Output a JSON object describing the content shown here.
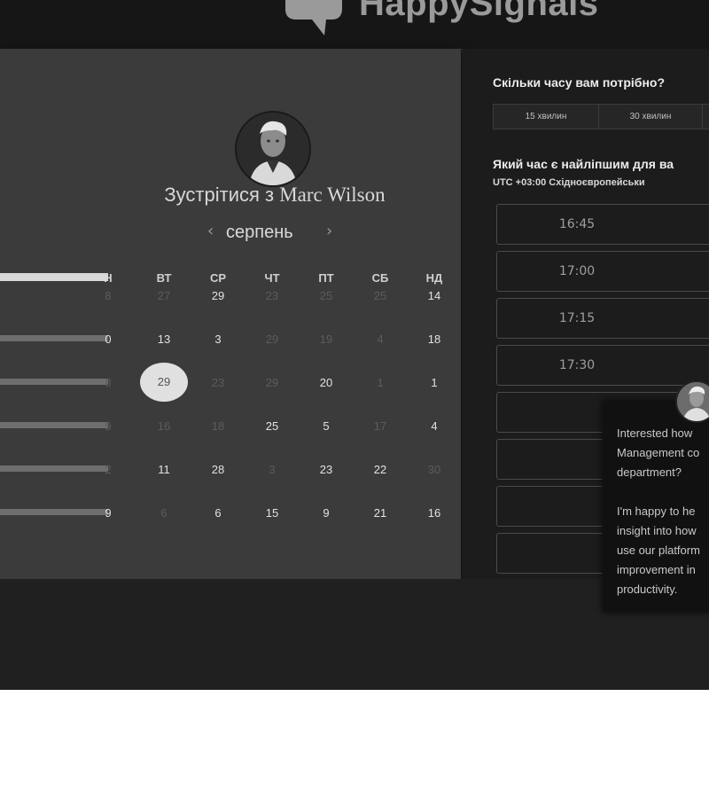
{
  "brand": {
    "name": "HappySignals"
  },
  "meeting": {
    "title_prefix": "Зустрітися з",
    "host_name": "Marc Wilson"
  },
  "calendar": {
    "month": "серпень",
    "prev_icon": "‹",
    "next_icon": "›",
    "day_headers": [
      "Н",
      "ВТ",
      "СР",
      "ЧТ",
      "ПТ",
      "СБ",
      "НД"
    ],
    "rows": [
      [
        {
          "d": "8",
          "s": "muted"
        },
        {
          "d": "27",
          "s": "muted"
        },
        {
          "d": "29",
          "s": "active"
        },
        {
          "d": "23",
          "s": "muted"
        },
        {
          "d": "25",
          "s": "muted"
        },
        {
          "d": "25",
          "s": "muted"
        },
        {
          "d": "14",
          "s": "active"
        }
      ],
      [
        {
          "d": "0",
          "s": "active"
        },
        {
          "d": "13",
          "s": "active"
        },
        {
          "d": "3",
          "s": "active"
        },
        {
          "d": "29",
          "s": "muted"
        },
        {
          "d": "19",
          "s": "muted"
        },
        {
          "d": "4",
          "s": "muted"
        },
        {
          "d": "18",
          "s": "active"
        }
      ],
      [
        {
          "d": "8",
          "s": "muted"
        },
        {
          "d": "29",
          "s": "selected"
        },
        {
          "d": "23",
          "s": "muted"
        },
        {
          "d": "29",
          "s": "muted"
        },
        {
          "d": "20",
          "s": "active"
        },
        {
          "d": "1",
          "s": "muted"
        },
        {
          "d": "1",
          "s": "active"
        }
      ],
      [
        {
          "d": "9",
          "s": "muted"
        },
        {
          "d": "16",
          "s": "muted"
        },
        {
          "d": "18",
          "s": "muted"
        },
        {
          "d": "25",
          "s": "active"
        },
        {
          "d": "5",
          "s": "active"
        },
        {
          "d": "17",
          "s": "muted"
        },
        {
          "d": "4",
          "s": "active"
        }
      ],
      [
        {
          "d": "2",
          "s": "muted"
        },
        {
          "d": "11",
          "s": "active"
        },
        {
          "d": "28",
          "s": "active"
        },
        {
          "d": "3",
          "s": "muted"
        },
        {
          "d": "23",
          "s": "active"
        },
        {
          "d": "22",
          "s": "active"
        },
        {
          "d": "30",
          "s": "muted"
        }
      ],
      [
        {
          "d": "9",
          "s": "active"
        },
        {
          "d": "6",
          "s": "muted"
        },
        {
          "d": "6",
          "s": "active"
        },
        {
          "d": "15",
          "s": "active"
        },
        {
          "d": "9",
          "s": "active"
        },
        {
          "d": "21",
          "s": "active"
        },
        {
          "d": "16",
          "s": "active"
        }
      ]
    ]
  },
  "duration": {
    "heading": "Скільки часу вам потрібно?",
    "options": [
      "15 хвилин",
      "30 хвилин",
      ""
    ]
  },
  "time_select": {
    "heading": "Який час є найліпшим для ва",
    "timezone": "UTC +03:00 Східноєвропейськи",
    "slots": [
      "16:45",
      "17:00",
      "17:15",
      "17:30",
      "",
      "",
      "",
      ""
    ]
  },
  "chat": {
    "lines": [
      "Interested how",
      "Management co",
      "department?",
      "",
      "I'm happy to he",
      "insight into how",
      "use our platform",
      "improvement in",
      "productivity."
    ]
  }
}
